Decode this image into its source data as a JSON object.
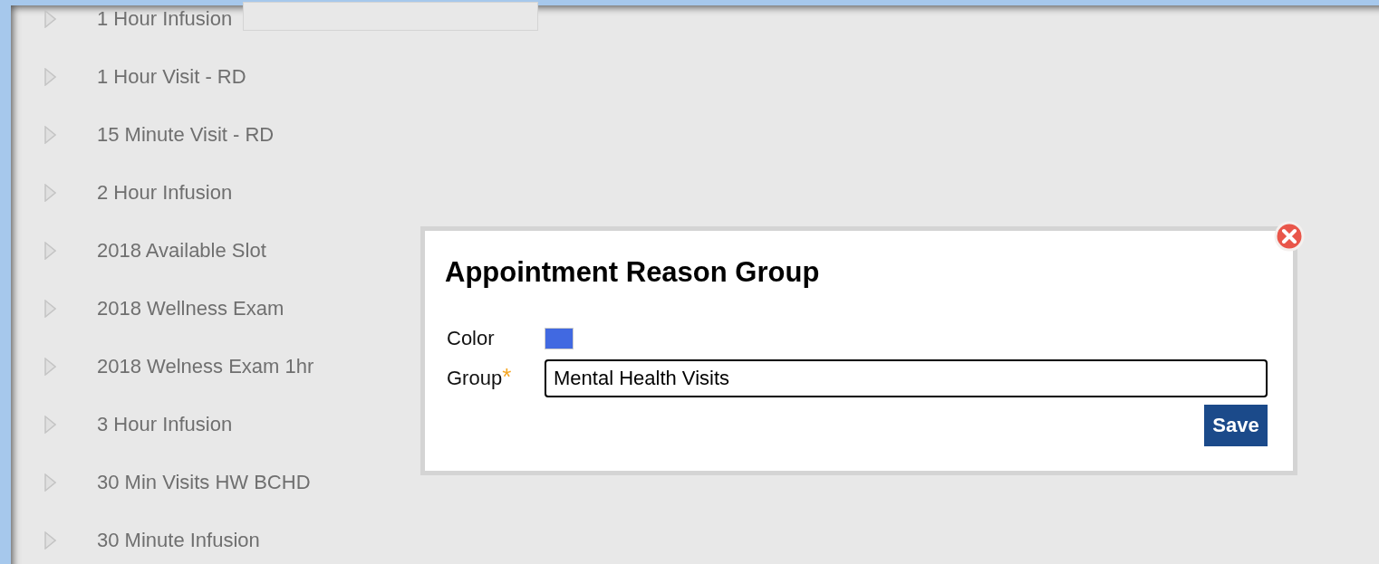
{
  "reasons": [
    {
      "label": "1 Hour Infusion",
      "expanded": false,
      "editing": true
    },
    {
      "label": "1 Hour Visit - RD",
      "expanded": false,
      "editing": false
    },
    {
      "label": "15 Minute Visit - RD",
      "expanded": false,
      "editing": false
    },
    {
      "label": "2 Hour Infusion",
      "expanded": false,
      "editing": false
    },
    {
      "label": "2018 Available Slot",
      "expanded": false,
      "editing": false
    },
    {
      "label": "2018 Wellness Exam",
      "expanded": false,
      "editing": false
    },
    {
      "label": "2018 Welness Exam 1hr",
      "expanded": false,
      "editing": false
    },
    {
      "label": "3 Hour Infusion",
      "expanded": false,
      "editing": false
    },
    {
      "label": "30 Min Visits HW BCHD",
      "expanded": false,
      "editing": false
    },
    {
      "label": "30 Minute Infusion",
      "expanded": false,
      "editing": false
    }
  ],
  "dialog": {
    "title": "Appointment Reason Group",
    "color_label": "Color",
    "color": "#4169e1",
    "group_label": "Group",
    "required_mark": "*",
    "group_value": "Mental Health Visits",
    "save": "Save"
  }
}
